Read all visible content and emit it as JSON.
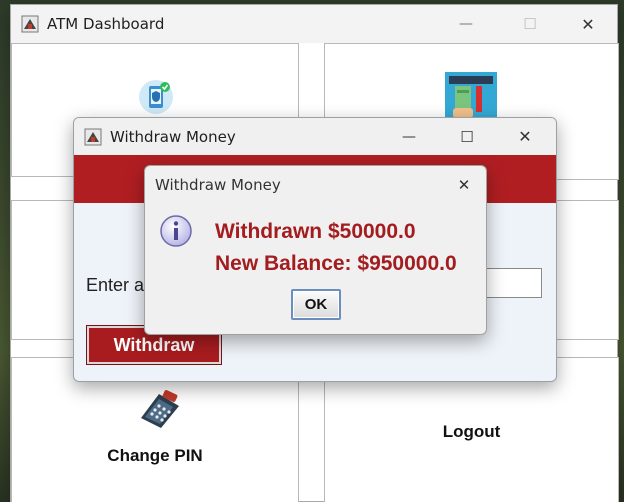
{
  "main_window": {
    "title": "ATM Dashboard",
    "controls": {
      "minimize": "—",
      "maximize": "☐",
      "close": "✕"
    },
    "panels": {
      "change_pin": "Change PIN",
      "logout": "Logout"
    }
  },
  "withdraw_window": {
    "title": "Withdraw Money",
    "controls": {
      "minimize": "—",
      "maximize": "☐",
      "close": "✕"
    },
    "amount_label": "Enter a",
    "amount_value": "",
    "withdraw_button": "Withdraw",
    "colors": {
      "banner": "#b01e22",
      "button": "#a81c1f"
    }
  },
  "message_dialog": {
    "title": "Withdraw Money",
    "close": "✕",
    "line1": "Withdrawn $50000.0",
    "line2": "New Balance: $950000.0",
    "ok_button": "OK",
    "colors": {
      "message_text": "#a31c1f"
    }
  },
  "icons": [
    "atm-app-icon",
    "mobile-shield-icon",
    "cash-withdraw-icon",
    "calculator-icon",
    "info-icon"
  ]
}
